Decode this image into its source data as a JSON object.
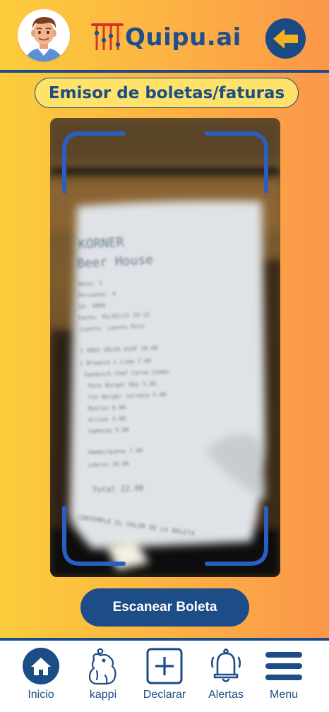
{
  "header": {
    "app_name": "Quipu.ai",
    "avatar_icon": "user-avatar",
    "back_icon": "arrow-left-icon"
  },
  "page": {
    "title": "Emisor de boletas/faturas"
  },
  "camera": {
    "receipt_lines": [
      "KORNER",
      "Beer House",
      "Mesa: 3",
      "Personas: 4",
      "Id: 4009",
      "Fecha: 01/02/23 19:12",
      "Cuenta: cuenta Pele",
      "1  GRAS VELVA 01AF   20.00",
      "1  Brownie C.Lime     7.00",
      "   Sandwich Chef Carne Combo",
      "   Pork Burger Rey     5.00",
      "   Yin Burger cerveza  5.00",
      "   Muslos              6.00",
      "   Alitas              3.00",
      "   Samosas             5.00",
      "   Hamburguesa        7.00",
      "   Lebron             10.00",
      "Total                 22.00",
      "CONTEMPLE EL VALOR DE LA BOLETA"
    ]
  },
  "actions": {
    "scan_label": "Escanear Boleta"
  },
  "nav": {
    "items": [
      {
        "label": "Inicio",
        "icon": "home-icon"
      },
      {
        "label": "kappi",
        "icon": "capybara-icon"
      },
      {
        "label": "Declarar",
        "icon": "plus-square-icon"
      },
      {
        "label": "Alertas",
        "icon": "bell-icon"
      },
      {
        "label": "Menu",
        "icon": "hamburger-menu-icon"
      }
    ]
  },
  "colors": {
    "primary": "#1c4d87",
    "gradient_start": "#fbcd3c",
    "gradient_end": "#fb964a",
    "pill_bg": "#ffe26a",
    "frame": "#2a5ec2"
  }
}
